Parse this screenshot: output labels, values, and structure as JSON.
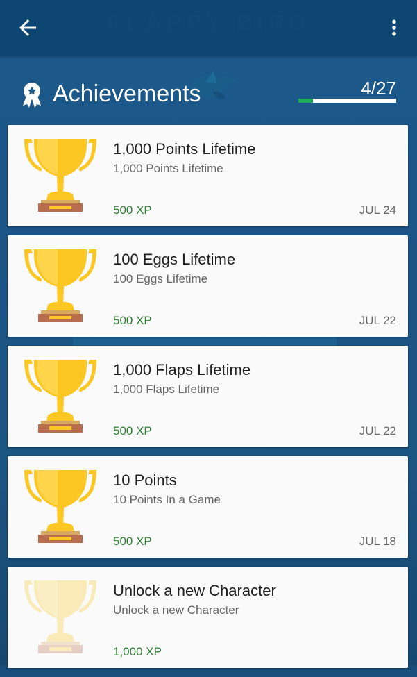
{
  "app_bar": {
    "back_icon": "arrow-left-icon",
    "faded_title": "FLAPPY BIRD",
    "menu_icon": "more-vert-icon"
  },
  "header": {
    "icon": "award-ribbon-icon",
    "title": "Achievements",
    "progress_text": "4/27",
    "progress_fraction": 0.148,
    "colors": {
      "progress_fill": "#1faa56",
      "progress_track": "#ffffff"
    }
  },
  "achievements": [
    {
      "title": "1,000 Points Lifetime",
      "description": "1,000 Points Lifetime",
      "xp": "500 XP",
      "date": "JUL 24",
      "unlocked": true
    },
    {
      "title": "100 Eggs Lifetime",
      "description": "100 Eggs Lifetime",
      "xp": "500 XP",
      "date": "JUL 22",
      "unlocked": true
    },
    {
      "title": "1,000 Flaps Lifetime",
      "description": "1,000 Flaps Lifetime",
      "xp": "500 XP",
      "date": "JUL 22",
      "unlocked": true
    },
    {
      "title": "10 Points",
      "description": "10 Points In a Game",
      "xp": "500 XP",
      "date": "JUL 18",
      "unlocked": true
    },
    {
      "title": "Unlock a new Character",
      "description": "Unlock a new Character",
      "xp": "1,000 XP",
      "date": "",
      "unlocked": false
    }
  ],
  "colors": {
    "app_bar": "#0d4670",
    "card_background": "#fafafa",
    "xp_text": "#2e7d32",
    "trophy_gold": "#fcc623",
    "trophy_base": "#b86e4e"
  }
}
